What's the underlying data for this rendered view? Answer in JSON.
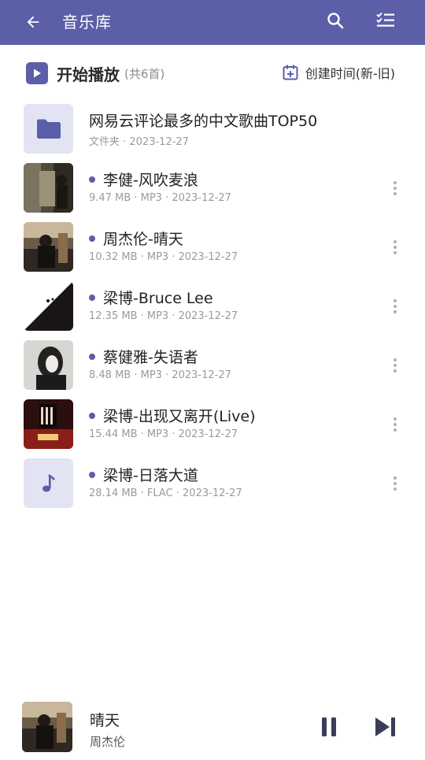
{
  "header": {
    "title": "音乐库",
    "back_icon": "arrow-left-icon",
    "search_icon": "search-icon",
    "select_icon": "checklist-icon"
  },
  "toolbar": {
    "play_all_label": "开始播放",
    "play_all_count": "(共6首)",
    "sort_label": "创建时间(新-旧)"
  },
  "items": [
    {
      "type": "folder",
      "title": "网易云评论最多的中文歌曲TOP50",
      "meta": "文件夹 · 2023-12-27"
    },
    {
      "type": "song",
      "title": "李健-风吹麦浪",
      "meta": "9.47 MB · MP3 · 2023-12-27"
    },
    {
      "type": "song",
      "title": "周杰伦-晴天",
      "meta": "10.32 MB · MP3 · 2023-12-27"
    },
    {
      "type": "song",
      "title": "梁博-Bruce Lee",
      "meta": "12.35 MB · MP3 · 2023-12-27"
    },
    {
      "type": "song",
      "title": "蔡健雅-失语者",
      "meta": "8.48 MB · MP3 · 2023-12-27"
    },
    {
      "type": "song",
      "title": "梁博-出现又离开(Live)",
      "meta": "15.44 MB · MP3 · 2023-12-27"
    },
    {
      "type": "song",
      "title": "梁博-日落大道",
      "meta": "28.14 MB · FLAC · 2023-12-27"
    }
  ],
  "player": {
    "song": "晴天",
    "artist": "周杰伦"
  },
  "colors": {
    "accent": "#5b5fa7",
    "thumb_bg": "#e3e4f3"
  }
}
